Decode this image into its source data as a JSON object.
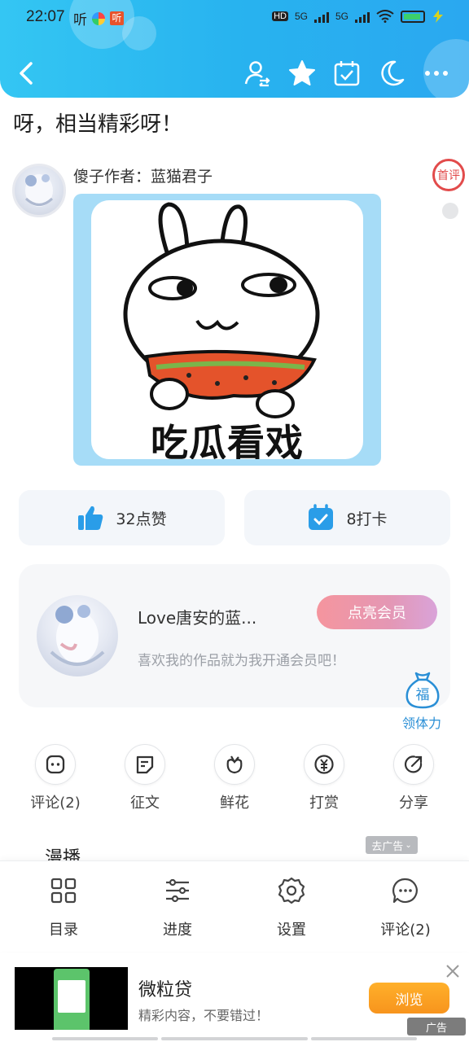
{
  "status_bar": {
    "time": "22:07",
    "listen_label": "听",
    "app_badge": "听",
    "net_hd": "HD",
    "net_5g_1": "5G",
    "net_5g_2": "5G"
  },
  "toolbar": {
    "icons": [
      "back-icon",
      "user-switch-icon",
      "star-icon",
      "calendar-check-icon",
      "moon-icon",
      "more-icon"
    ]
  },
  "content": {
    "title": "呀，相当精彩呀！",
    "comment_author": "傻子作者：蓝猫君子",
    "first_badge": "首评",
    "sticker_text": "吃瓜看戏"
  },
  "actions": {
    "like_label": "32点赞",
    "checkin_label": "8打卡"
  },
  "member": {
    "name": "Love唐安的蓝...",
    "vip_button": "点亮会员",
    "description": "喜欢我的作品就为我开通会员吧！",
    "fu_char": "福",
    "fu_label": "领体力"
  },
  "tools": [
    {
      "label": "评论(2)",
      "icon": "comment-icon"
    },
    {
      "label": "征文",
      "icon": "essay-icon"
    },
    {
      "label": "鲜花",
      "icon": "flower-icon"
    },
    {
      "label": "打赏",
      "icon": "reward-icon"
    },
    {
      "label": "分享",
      "icon": "share-icon"
    }
  ],
  "section": {
    "manbo": "漫播",
    "remove_ad": "去广告"
  },
  "bottom_bar": [
    {
      "label": "目录",
      "icon": "catalog-icon"
    },
    {
      "label": "进度",
      "icon": "progress-icon"
    },
    {
      "label": "设置",
      "icon": "settings-icon"
    },
    {
      "label": "评论(2)",
      "icon": "comment-bubble-icon"
    }
  ],
  "ad": {
    "title": "微粒贷",
    "subtitle": "精彩内容，不要错过！",
    "button": "浏览",
    "ad_label": "广告"
  },
  "colors": {
    "header": "#2fb8f2",
    "accent_blue": "#2a9de8",
    "vip_pink": "#f095a3",
    "ad_orange": "#f7941d"
  }
}
